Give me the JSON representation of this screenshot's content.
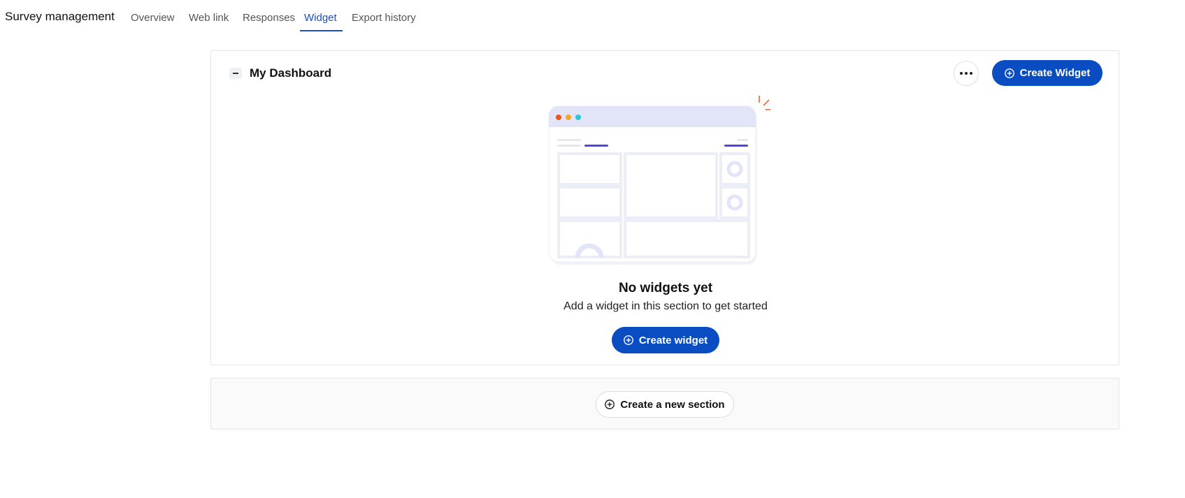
{
  "header": {
    "title": "Survey management",
    "tabs": [
      {
        "label": "Overview"
      },
      {
        "label": "Web link"
      },
      {
        "label": "Responses"
      },
      {
        "label": "Widget",
        "active": true
      },
      {
        "label": "Export history"
      }
    ]
  },
  "dashboard": {
    "title": "My Dashboard",
    "more_icon": "ellipsis-icon",
    "create_widget_label": "Create Widget",
    "empty_state": {
      "title": "No widgets yet",
      "subtitle": "Add a widget in this section to get started",
      "button_label": "Create widget"
    }
  },
  "new_section": {
    "button_label": "Create a new section"
  },
  "colors": {
    "accent": "#1a4fc9",
    "primary_button": "#0a4cc2",
    "illustration_bar": "#e2e4f8",
    "illustration_accent": "#4f46e5",
    "dot_red": "#f2541b",
    "dot_orange": "#f5a623",
    "dot_teal": "#2cc6d4"
  }
}
